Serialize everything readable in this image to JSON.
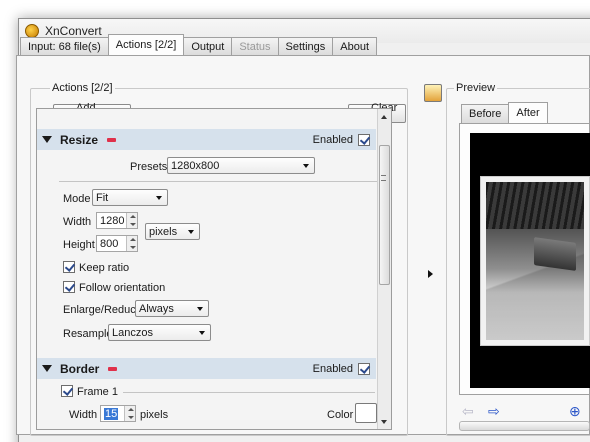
{
  "window": {
    "title": "XnConvert"
  },
  "tabs": [
    {
      "label": "Input: 68 file(s)"
    },
    {
      "label": "Actions [2/2]"
    },
    {
      "label": "Output"
    },
    {
      "label": "Status"
    },
    {
      "label": "Settings"
    },
    {
      "label": "About"
    }
  ],
  "actions": {
    "group_title": "Actions [2/2]",
    "add_label": "Add action>",
    "clear_label": "Clear all",
    "resize": {
      "name": "Resize",
      "enabled_label": "Enabled",
      "enabled": true,
      "presets_label": "Presets",
      "presets_value": "1280x800",
      "mode_label": "Mode",
      "mode_value": "Fit",
      "width_label": "Width",
      "width_value": "1280",
      "height_label": "Height",
      "height_value": "800",
      "unit_value": "pixels",
      "keep_ratio_label": "Keep ratio",
      "keep_ratio": true,
      "follow_orientation_label": "Follow orientation",
      "follow_orientation": true,
      "enlarge_label": "Enlarge/Reduce",
      "enlarge_value": "Always",
      "resample_label": "Resample",
      "resample_value": "Lanczos"
    },
    "border": {
      "name": "Border",
      "enabled_label": "Enabled",
      "enabled": true,
      "frame_label": "Frame 1",
      "frame_checked": true,
      "width_label": "Width",
      "width_value": "15",
      "unit_label": "pixels",
      "color_label": "Color"
    }
  },
  "preview": {
    "title": "Preview",
    "tabs": [
      {
        "label": "Before"
      },
      {
        "label": "After"
      }
    ]
  }
}
